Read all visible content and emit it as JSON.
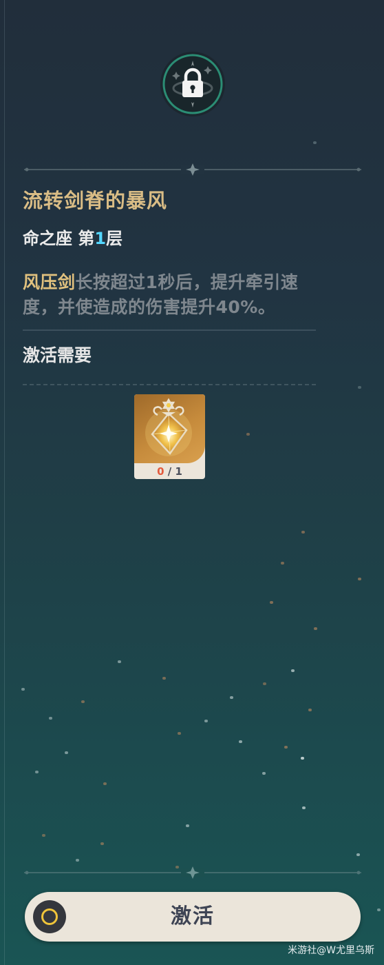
{
  "constellation": {
    "title": "流转剑脊的暴风",
    "level_prefix": "命之座 第",
    "level_number": "1",
    "level_suffix": "层",
    "status_icon": "lock-icon",
    "description_highlight": "风压剑",
    "description_rest": "长按超过1秒后，提升牵引速度，并使造成的伤害提升40%。"
  },
  "requirement": {
    "label": "激活需要",
    "item_icon": "constellation-activation-material-icon",
    "have": "0",
    "separator": " / ",
    "need": "1"
  },
  "action": {
    "activate_label": "激活",
    "button_icon": "confirm-ring-icon"
  },
  "watermark": "米游社@W尤里乌斯",
  "colors": {
    "title_gold": "#d9bc85",
    "highlight_gold": "#e1c17e",
    "level_cyan": "#54d7ff",
    "insufficient_red": "#e35a3c",
    "button_bg": "#ebe5da"
  }
}
